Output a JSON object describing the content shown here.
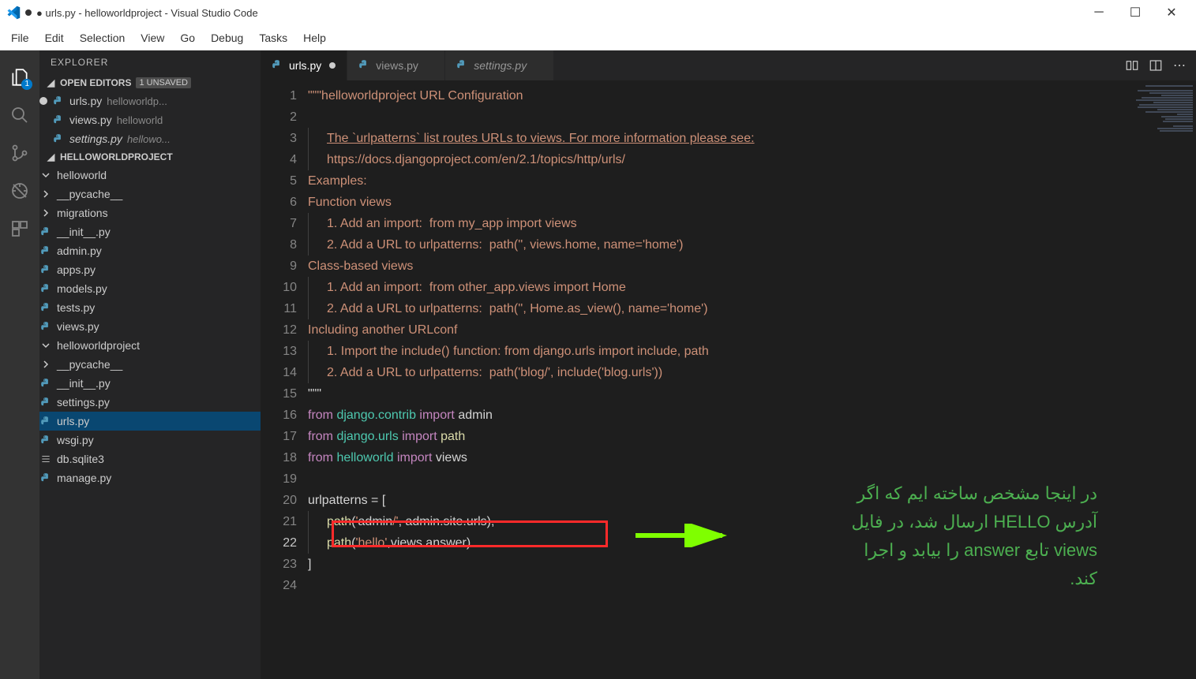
{
  "window": {
    "title": "● urls.py - helloworldproject - Visual Studio Code"
  },
  "menu": [
    "File",
    "Edit",
    "Selection",
    "View",
    "Go",
    "Debug",
    "Tasks",
    "Help"
  ],
  "activitybar": {
    "badge": "1"
  },
  "explorer": {
    "title": "EXPLORER",
    "open_editors_label": "OPEN EDITORS",
    "unsaved_tag": "1 UNSAVED",
    "open_editors": [
      {
        "name": "urls.py",
        "path": "helloworldp...",
        "modified": true
      },
      {
        "name": "views.py",
        "path": "helloworld",
        "modified": false
      },
      {
        "name": "settings.py",
        "path": "hellowo...",
        "modified": false,
        "italic": true
      }
    ],
    "project_label": "HELLOWORLDPROJECT",
    "tree": [
      {
        "type": "folder",
        "open": true,
        "depth": 1,
        "name": "helloworld"
      },
      {
        "type": "folder",
        "open": false,
        "depth": 2,
        "name": "__pycache__"
      },
      {
        "type": "folder",
        "open": false,
        "depth": 2,
        "name": "migrations"
      },
      {
        "type": "py",
        "depth": 2,
        "name": "__init__.py"
      },
      {
        "type": "py",
        "depth": 2,
        "name": "admin.py"
      },
      {
        "type": "py",
        "depth": 2,
        "name": "apps.py"
      },
      {
        "type": "py",
        "depth": 2,
        "name": "models.py"
      },
      {
        "type": "py",
        "depth": 2,
        "name": "tests.py"
      },
      {
        "type": "py",
        "depth": 2,
        "name": "views.py"
      },
      {
        "type": "folder",
        "open": true,
        "depth": 1,
        "name": "helloworldproject"
      },
      {
        "type": "folder",
        "open": false,
        "depth": 2,
        "name": "__pycache__"
      },
      {
        "type": "py",
        "depth": 2,
        "name": "__init__.py"
      },
      {
        "type": "py",
        "depth": 2,
        "name": "settings.py"
      },
      {
        "type": "py",
        "depth": 2,
        "name": "urls.py",
        "selected": true
      },
      {
        "type": "py",
        "depth": 2,
        "name": "wsgi.py"
      },
      {
        "type": "db",
        "depth": 1,
        "name": "db.sqlite3"
      },
      {
        "type": "py",
        "depth": 1,
        "name": "manage.py"
      }
    ]
  },
  "tabs": [
    {
      "name": "urls.py",
      "active": true,
      "modified": true
    },
    {
      "name": "views.py",
      "active": false,
      "modified": false
    },
    {
      "name": "settings.py",
      "active": false,
      "modified": false,
      "italic": true
    }
  ],
  "code": {
    "lines": [
      "\"\"\"helloworldproject URL Configuration",
      "",
      "The `urlpatterns` list routes URLs to views. For more information please see:",
      "    https://docs.djangoproject.com/en/2.1/topics/http/urls/",
      "Examples:",
      "Function views",
      "    1. Add an import:  from my_app import views",
      "    2. Add a URL to urlpatterns:  path('', views.home, name='home')",
      "Class-based views",
      "    1. Add an import:  from other_app.views import Home",
      "    2. Add a URL to urlpatterns:  path('', Home.as_view(), name='home')",
      "Including another URLconf",
      "    1. Import the include() function: from django.urls import include, path",
      "    2. Add a URL to urlpatterns:  path('blog/', include('blog.urls'))",
      "\"\"\"",
      "from django.contrib import admin",
      "from django.urls import path",
      "from helloworld import views",
      "",
      "urlpatterns = [",
      "    path('admin/', admin.site.urls),",
      "    path('hello',views.answer)",
      "]",
      ""
    ],
    "current_line": 22
  },
  "annotation": {
    "line1": "در اینجا مشخص ساخته ایم که اگر",
    "line2_a": "آدرس ",
    "line2_b": "HELLO",
    "line2_c": " ارسال شد، در  فایل",
    "line3_a": "views",
    "line3_b": " تابع ",
    "line3_c": "answer",
    "line3_d": " را بیابد و اجرا",
    "line4": "کند."
  }
}
